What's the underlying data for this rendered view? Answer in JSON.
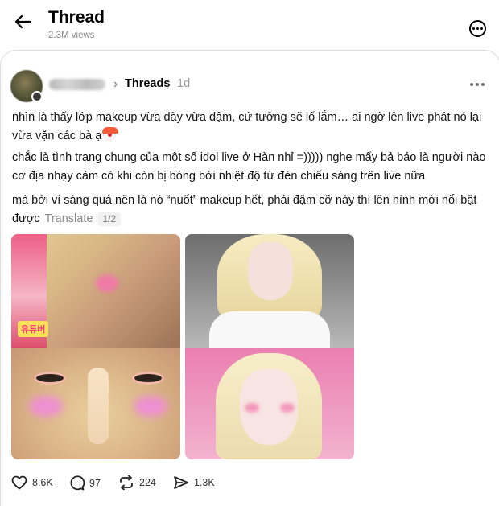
{
  "header": {
    "title": "Thread",
    "views": "2.3M views"
  },
  "post": {
    "source": "Threads",
    "time": "1d",
    "paragraphs": [
      "nhìn là thấy lớp makeup vừa dày vừa đậm, cứ tưởng sẽ lố lắm… ai ngờ lên live phát nó lại vừa vặn các bà ạ",
      "chắc là tình trạng chung của một số idol live ở Hàn nhỉ =))))) nghe mấy bả báo là người nào cơ địa nhạy cảm có khi còn bị bóng bởi nhiệt độ từ đèn chiếu sáng trên live nữa",
      "mà bởi vì sáng quá nên là nó “nuốt” makeup hết, phải đậm cỡ này thì lên hình mới nổi bật được"
    ],
    "emoji": "clown-face",
    "translate_label": "Translate",
    "page_indicator": "1/2",
    "image_tag": "유튜버"
  },
  "actions": {
    "likes": "8.6K",
    "comments": "97",
    "reposts": "224",
    "shares": "1.3K"
  },
  "icons": [
    "back-arrow-icon",
    "more-options-icon",
    "chevron-right-icon",
    "heart-icon",
    "comment-icon",
    "repost-icon",
    "share-icon"
  ],
  "colors": {
    "secondary_text": "#8a8a8a",
    "border": "#dcdcdc"
  }
}
